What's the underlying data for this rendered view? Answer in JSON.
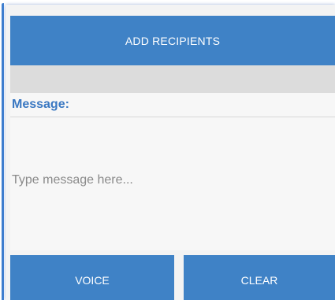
{
  "header": {
    "add_recipients_label": "ADD RECIPIENTS"
  },
  "message": {
    "label": "Message:",
    "placeholder": "Type message here...",
    "value": ""
  },
  "actions": {
    "voice_label": "VOICE",
    "clear_label": "CLEAR"
  },
  "colors": {
    "button_blue": "#3f82c6",
    "label_blue": "#3a78c2",
    "strip_gray": "#dcdcdc"
  }
}
